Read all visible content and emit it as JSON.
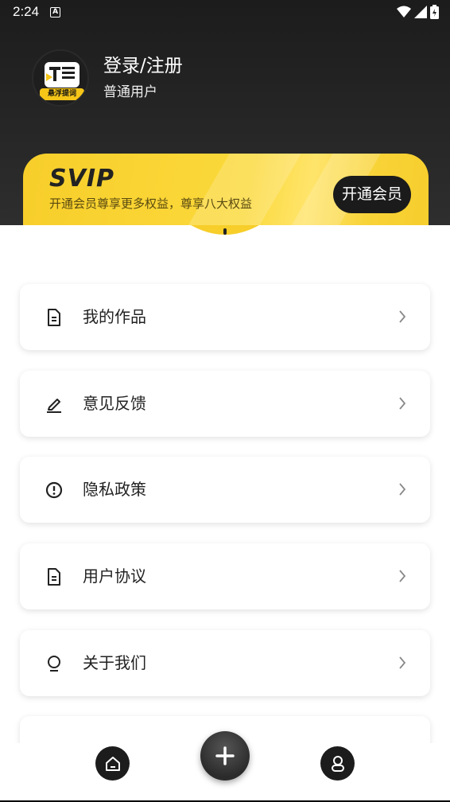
{
  "status_bar": {
    "time": "2:24",
    "notification_icon": "A"
  },
  "profile": {
    "title": "登录/注册",
    "subtitle": "普通用户",
    "avatar_icon": "teleprompter-logo",
    "avatar_text": "悬浮提词"
  },
  "svip": {
    "logo": "SVIP",
    "description": "开通会员尊享更多权益，尊享八大权益",
    "button_label": "开通会员",
    "accent_color": "#f7ce2a"
  },
  "menu": {
    "items": [
      {
        "label": "我的作品",
        "icon": "document-icon"
      },
      {
        "label": "意见反馈",
        "icon": "pen-icon"
      },
      {
        "label": "隐私政策",
        "icon": "info-circle-icon"
      },
      {
        "label": "用户协议",
        "icon": "document-icon"
      },
      {
        "label": "关于我们",
        "icon": "bulb-icon"
      }
    ]
  },
  "bottom_nav": {
    "items": [
      "home-icon",
      "add-icon",
      "profile-icon"
    ]
  }
}
